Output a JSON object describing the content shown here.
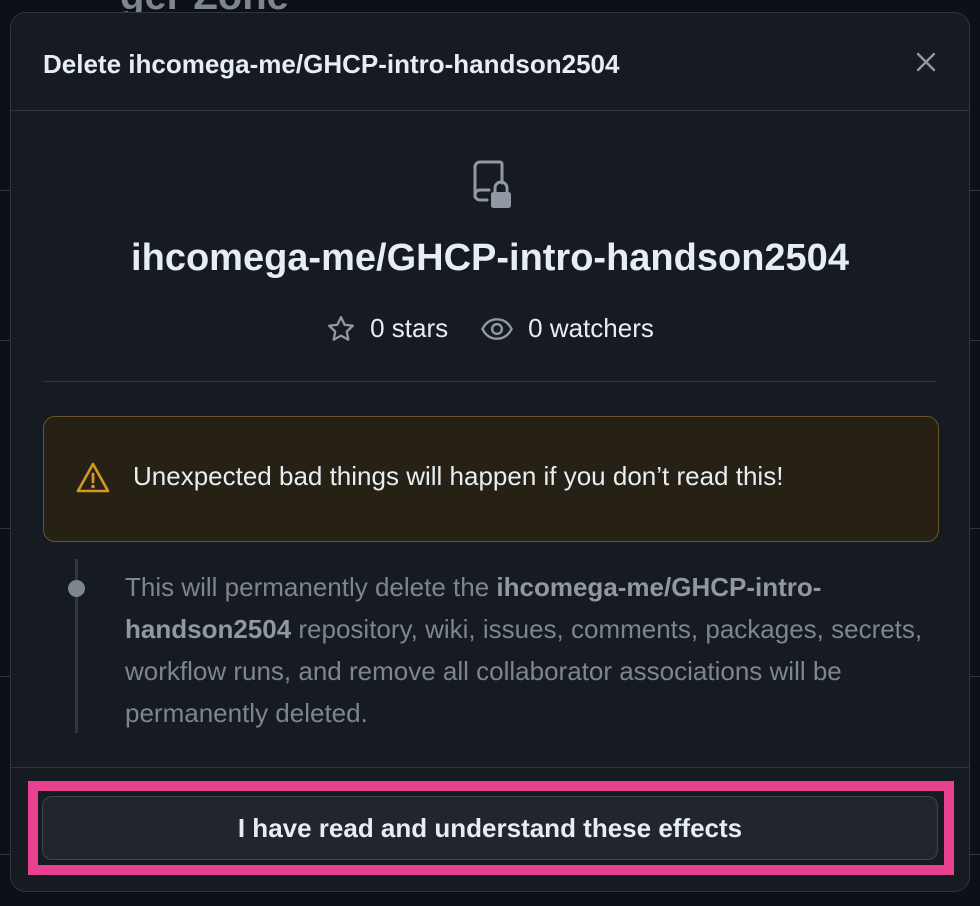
{
  "background": {
    "heading": "ger Zone"
  },
  "dialog": {
    "title": "Delete ihcomega-me/GHCP-intro-handson2504",
    "close_icon": "x-icon",
    "repo_icon": "repo-locked-icon",
    "repo_name": "ihcomega-me/GHCP-intro-handson2504",
    "stats": {
      "stars": "0 stars",
      "watchers": "0 watchers"
    },
    "warning": {
      "icon": "alert-triangle-icon",
      "text": "Unexpected bad things will happen if you don’t read this!"
    },
    "info": {
      "prefix": "This will permanently delete the ",
      "repo_bold": "ihcomega-me/GHCP-intro-handson2504",
      "suffix": " repository, wiki, issues, comments, packages, secrets, workflow runs, and remove all collaborator associations will be permanently deleted."
    },
    "confirm_button": "I have read and understand these effects"
  },
  "colors": {
    "dialog_bg": "#161b22",
    "border": "#30363d",
    "warning_bg": "#272115",
    "warning_border": "#6a5429",
    "warning_icon": "#d29922",
    "highlight": "#e8418f"
  }
}
